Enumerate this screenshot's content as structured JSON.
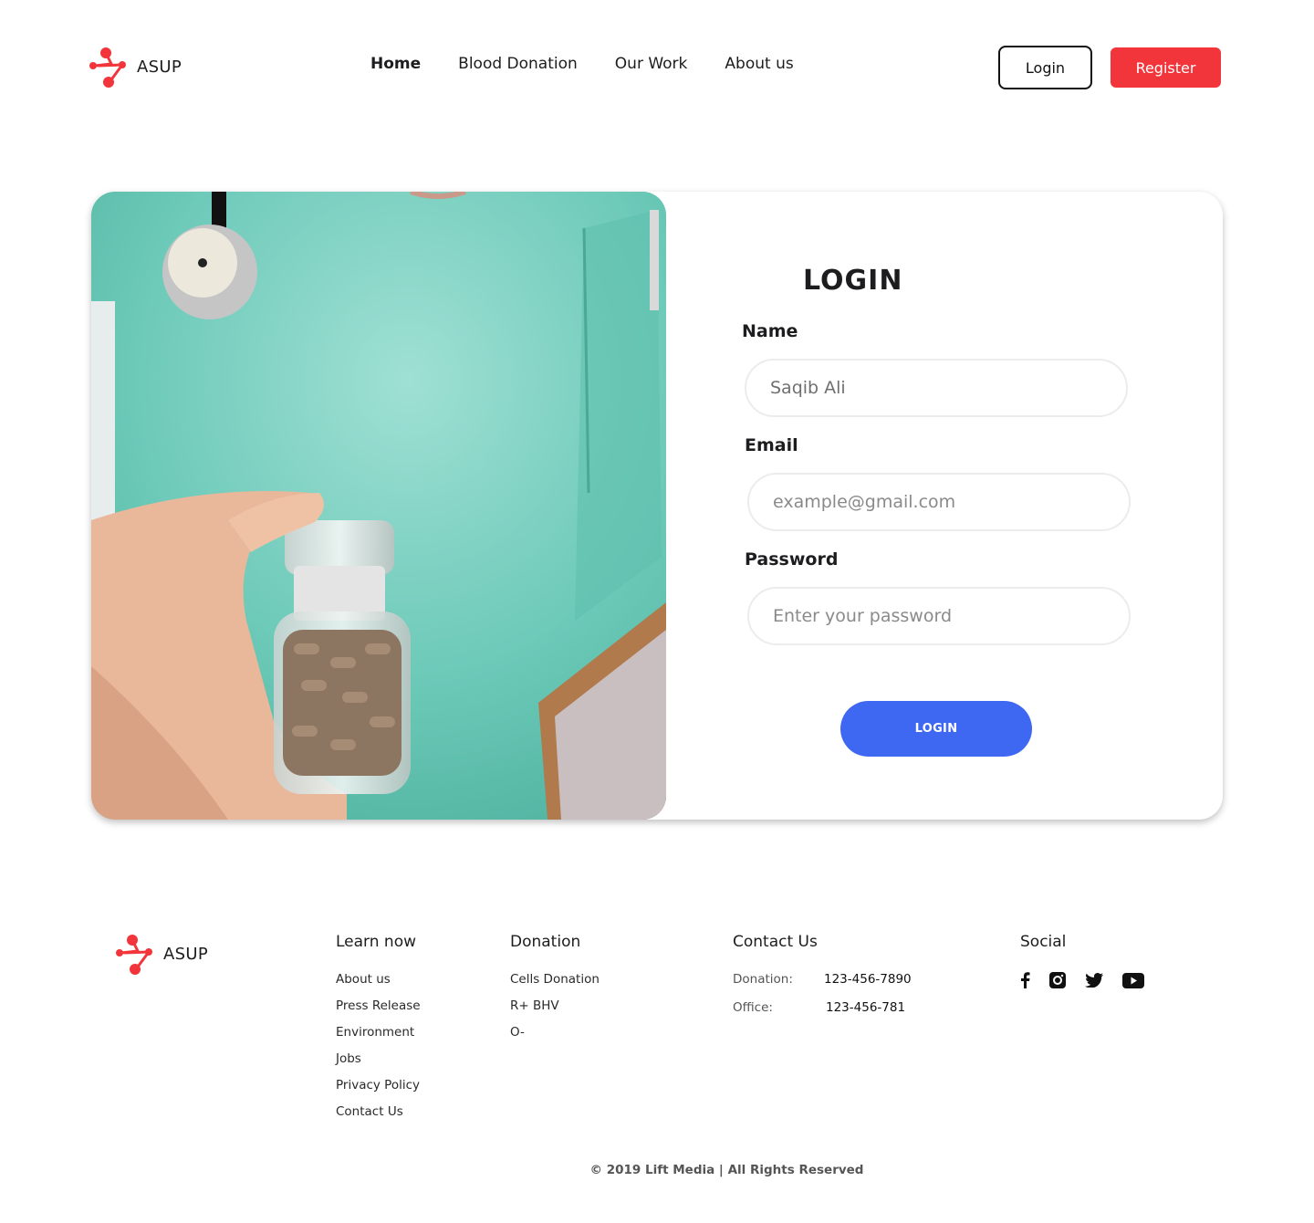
{
  "brand": {
    "name": "ASUP",
    "color": "#f2353a"
  },
  "nav": {
    "items": [
      "Home",
      "Blood Donation",
      "Our Work",
      "About us"
    ],
    "active": "Home"
  },
  "header_buttons": {
    "login": "Login",
    "register": "Register"
  },
  "form": {
    "title": "LOGIN",
    "name_label": "Name",
    "name_value": "Saqib Ali",
    "email_label": "Email",
    "email_placeholder": "example@gmail.com",
    "password_label": "Password",
    "password_placeholder": "Enter your password",
    "submit": "LOGIN",
    "submit_color": "#3e68f2"
  },
  "footer": {
    "brand": "ASUP",
    "learn": {
      "heading": "Learn now",
      "links": [
        "About us",
        "Press Release",
        "Environment",
        "Jobs",
        "Privacy Policy",
        "Contact Us"
      ]
    },
    "donation": {
      "heading": "Donation",
      "links": [
        "Cells Donation",
        "R+ BHV",
        "O-"
      ]
    },
    "contact": {
      "heading": "Contact Us",
      "rows": [
        {
          "label": "Donation:",
          "value": "123-456-7890"
        },
        {
          "label": "Office:",
          "value": "123-456-781"
        }
      ]
    },
    "social": {
      "heading": "Social",
      "icons": [
        "facebook-icon",
        "instagram-icon",
        "twitter-icon",
        "youtube-icon"
      ]
    },
    "copyright": "© 2019 Lift Media | All Rights Reserved"
  }
}
